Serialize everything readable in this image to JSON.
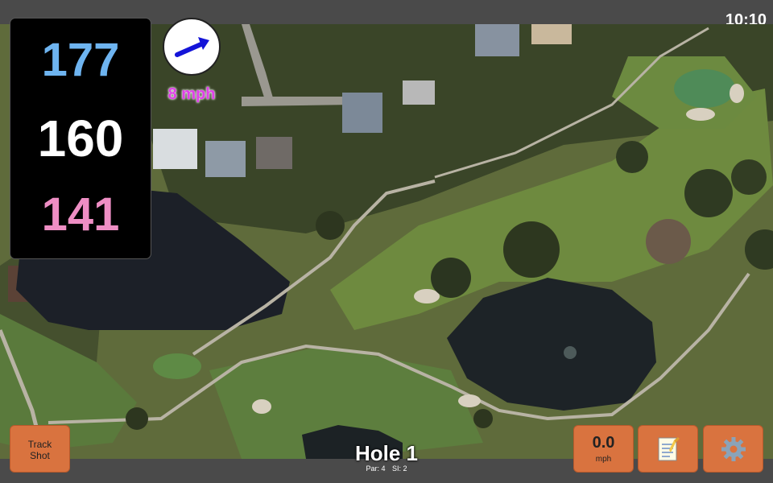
{
  "status": {
    "time": "10:10"
  },
  "distances": {
    "back": "177",
    "middle": "160",
    "front": "141"
  },
  "wind": {
    "speed": "8 mph",
    "icon": "wind-arrow-icon",
    "direction": "east-northeast"
  },
  "hole": {
    "title": "Hole 1",
    "par": "Par: 4",
    "stroke_index": "SI: 2"
  },
  "buttons": {
    "track_shot_line1": "Track",
    "track_shot_line2": "Shot",
    "speed_value": "0.0",
    "speed_unit": "mph",
    "notes_icon": "notepad-icon",
    "settings_icon": "gear-icon"
  },
  "colors": {
    "back_distance": "#6eb4f0",
    "middle_distance": "#ffffff",
    "front_distance": "#ee8ec4",
    "wind_text": "#e040e8",
    "button": "#d9733f",
    "bar": "#4a4a4a"
  }
}
